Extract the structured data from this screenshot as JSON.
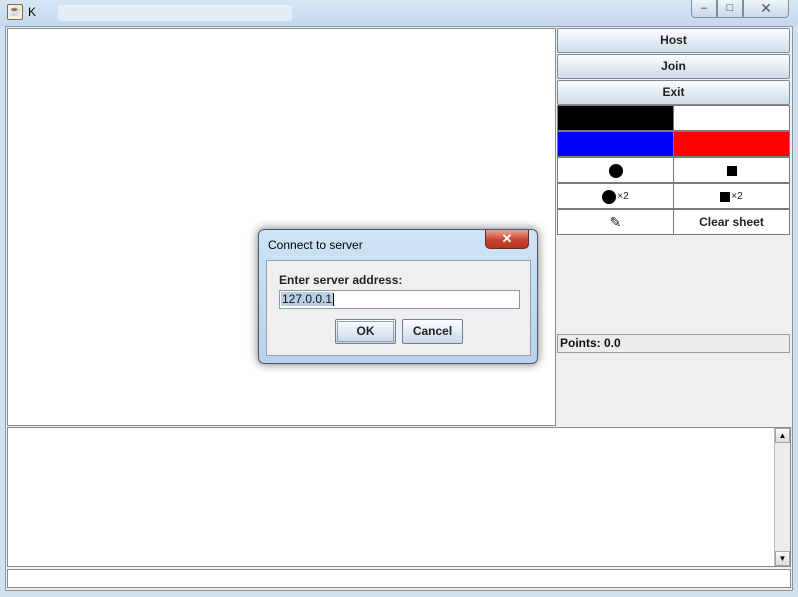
{
  "window": {
    "title": "K",
    "controls": {
      "minimize": "–",
      "maximize": "□",
      "close": "✕"
    }
  },
  "panel": {
    "host_label": "Host",
    "join_label": "Join",
    "exit_label": "Exit",
    "colors": [
      "#000000",
      "#ffffff",
      "#0000ff",
      "#ff0000"
    ],
    "shape_multiplier": "×2",
    "pen_icon": "✎",
    "clear_label": "Clear sheet",
    "points_label": "Points: 0.0"
  },
  "dialog": {
    "title": "Connect to server",
    "close_glyph": "✕",
    "prompt": "Enter server address:",
    "input_value": "127.0.0.1",
    "ok_label": "OK",
    "cancel_label": "Cancel"
  },
  "log": {
    "scroll_up": "▲",
    "scroll_down": "▼"
  }
}
